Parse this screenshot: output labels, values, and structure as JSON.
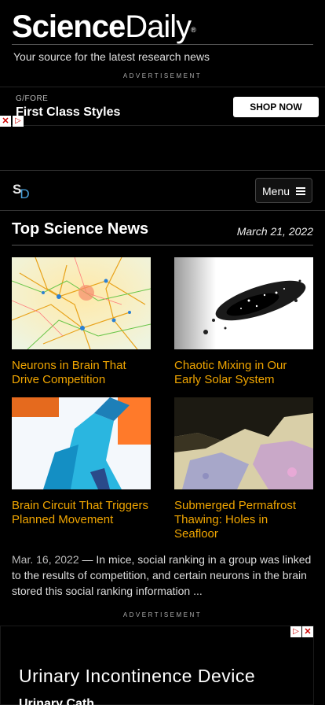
{
  "masthead": {
    "logo_bold": "Science",
    "logo_thin": "Daily",
    "logo_mark": "®",
    "tagline": "Your source for the latest research news"
  },
  "ad_top": {
    "label": "ADVERTISEMENT",
    "brand": "G/FORE",
    "headline": "First Class Styles",
    "cta": "SHOP NOW"
  },
  "nav": {
    "logo_s": "S",
    "logo_d": "D",
    "menu_label": "Menu"
  },
  "section": {
    "title": "Top Science News",
    "date": "March 21, 2022"
  },
  "stories": [
    {
      "title": "Neurons in Brain That Drive Competition"
    },
    {
      "title": "Chaotic Mixing in Our Early Solar System"
    },
    {
      "title": "Brain Circuit That Triggers Planned Movement"
    },
    {
      "title": "Submerged Permafrost Thawing: Holes in Seafloor"
    }
  ],
  "summary": {
    "date": "Mar. 16, 2022",
    "dash": " — ",
    "text": "In mice, social ranking in a group was linked to the results of competition, and certain neurons in the brain stored this social ranking information ..."
  },
  "ad_bottom": {
    "label": "ADVERTISEMENT",
    "title": "Urinary Incontinence Device",
    "sub": "Urinary Cath..."
  },
  "colors": {
    "link": "#f0a500",
    "accent": "#4aa3df"
  }
}
